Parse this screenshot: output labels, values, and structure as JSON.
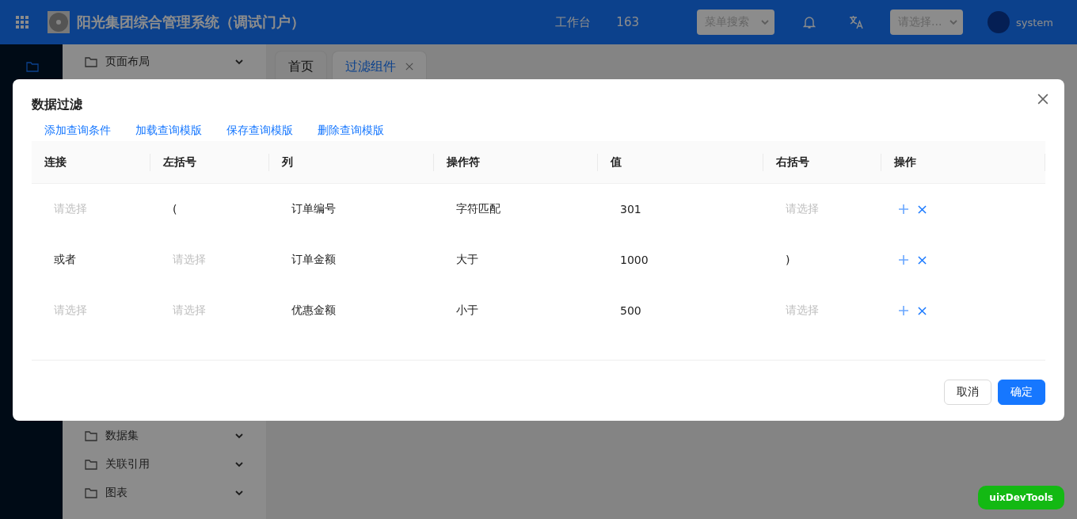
{
  "header": {
    "title": "阳光集团综合管理系统（调试门户）",
    "workbench": "工作台",
    "count": "163",
    "menu_search": {
      "placeholder": "菜单搜索"
    },
    "portal_select": {
      "placeholder": "请选择..."
    },
    "user": "system"
  },
  "sidebar": {
    "items": [
      {
        "label": "页面布局",
        "expanded": false
      },
      {
        "label": "数据集",
        "expanded": false
      },
      {
        "label": "关联引用",
        "expanded": false
      },
      {
        "label": "图表",
        "expanded": false
      }
    ]
  },
  "tabs": [
    {
      "label": "首页",
      "selected": false,
      "closable": false
    },
    {
      "label": "过滤组件",
      "selected": true,
      "closable": true
    }
  ],
  "dialog": {
    "title": "数据过滤",
    "links": [
      "添加查询条件",
      "加载查询模版",
      "保存查询模版",
      "删除查询模版"
    ],
    "table": {
      "columns": [
        "连接",
        "左括号",
        "列",
        "操作符",
        "值",
        "右括号",
        "操作"
      ],
      "rows": [
        {
          "cells": [
            {
              "placeholder": "请选择"
            },
            {
              "value": "("
            },
            {
              "value": "订单编号"
            },
            {
              "value": "字符匹配"
            },
            {
              "value": "301"
            },
            {
              "placeholder": "请选择"
            }
          ]
        },
        {
          "cells": [
            {
              "value": "或者"
            },
            {
              "placeholder": "请选择"
            },
            {
              "value": "订单金额"
            },
            {
              "value": "大于"
            },
            {
              "value": "1000"
            },
            {
              "value": ")"
            }
          ]
        },
        {
          "cells": [
            {
              "placeholder": "请选择"
            },
            {
              "placeholder": "请选择"
            },
            {
              "value": "优惠金额"
            },
            {
              "value": "小于"
            },
            {
              "value": "500"
            },
            {
              "placeholder": "请选择"
            }
          ]
        }
      ]
    },
    "buttons": [
      {
        "label": "取消",
        "kind": "default"
      },
      {
        "label": "确定",
        "kind": "primary"
      }
    ]
  },
  "dev_badge": "uixDevTools"
}
